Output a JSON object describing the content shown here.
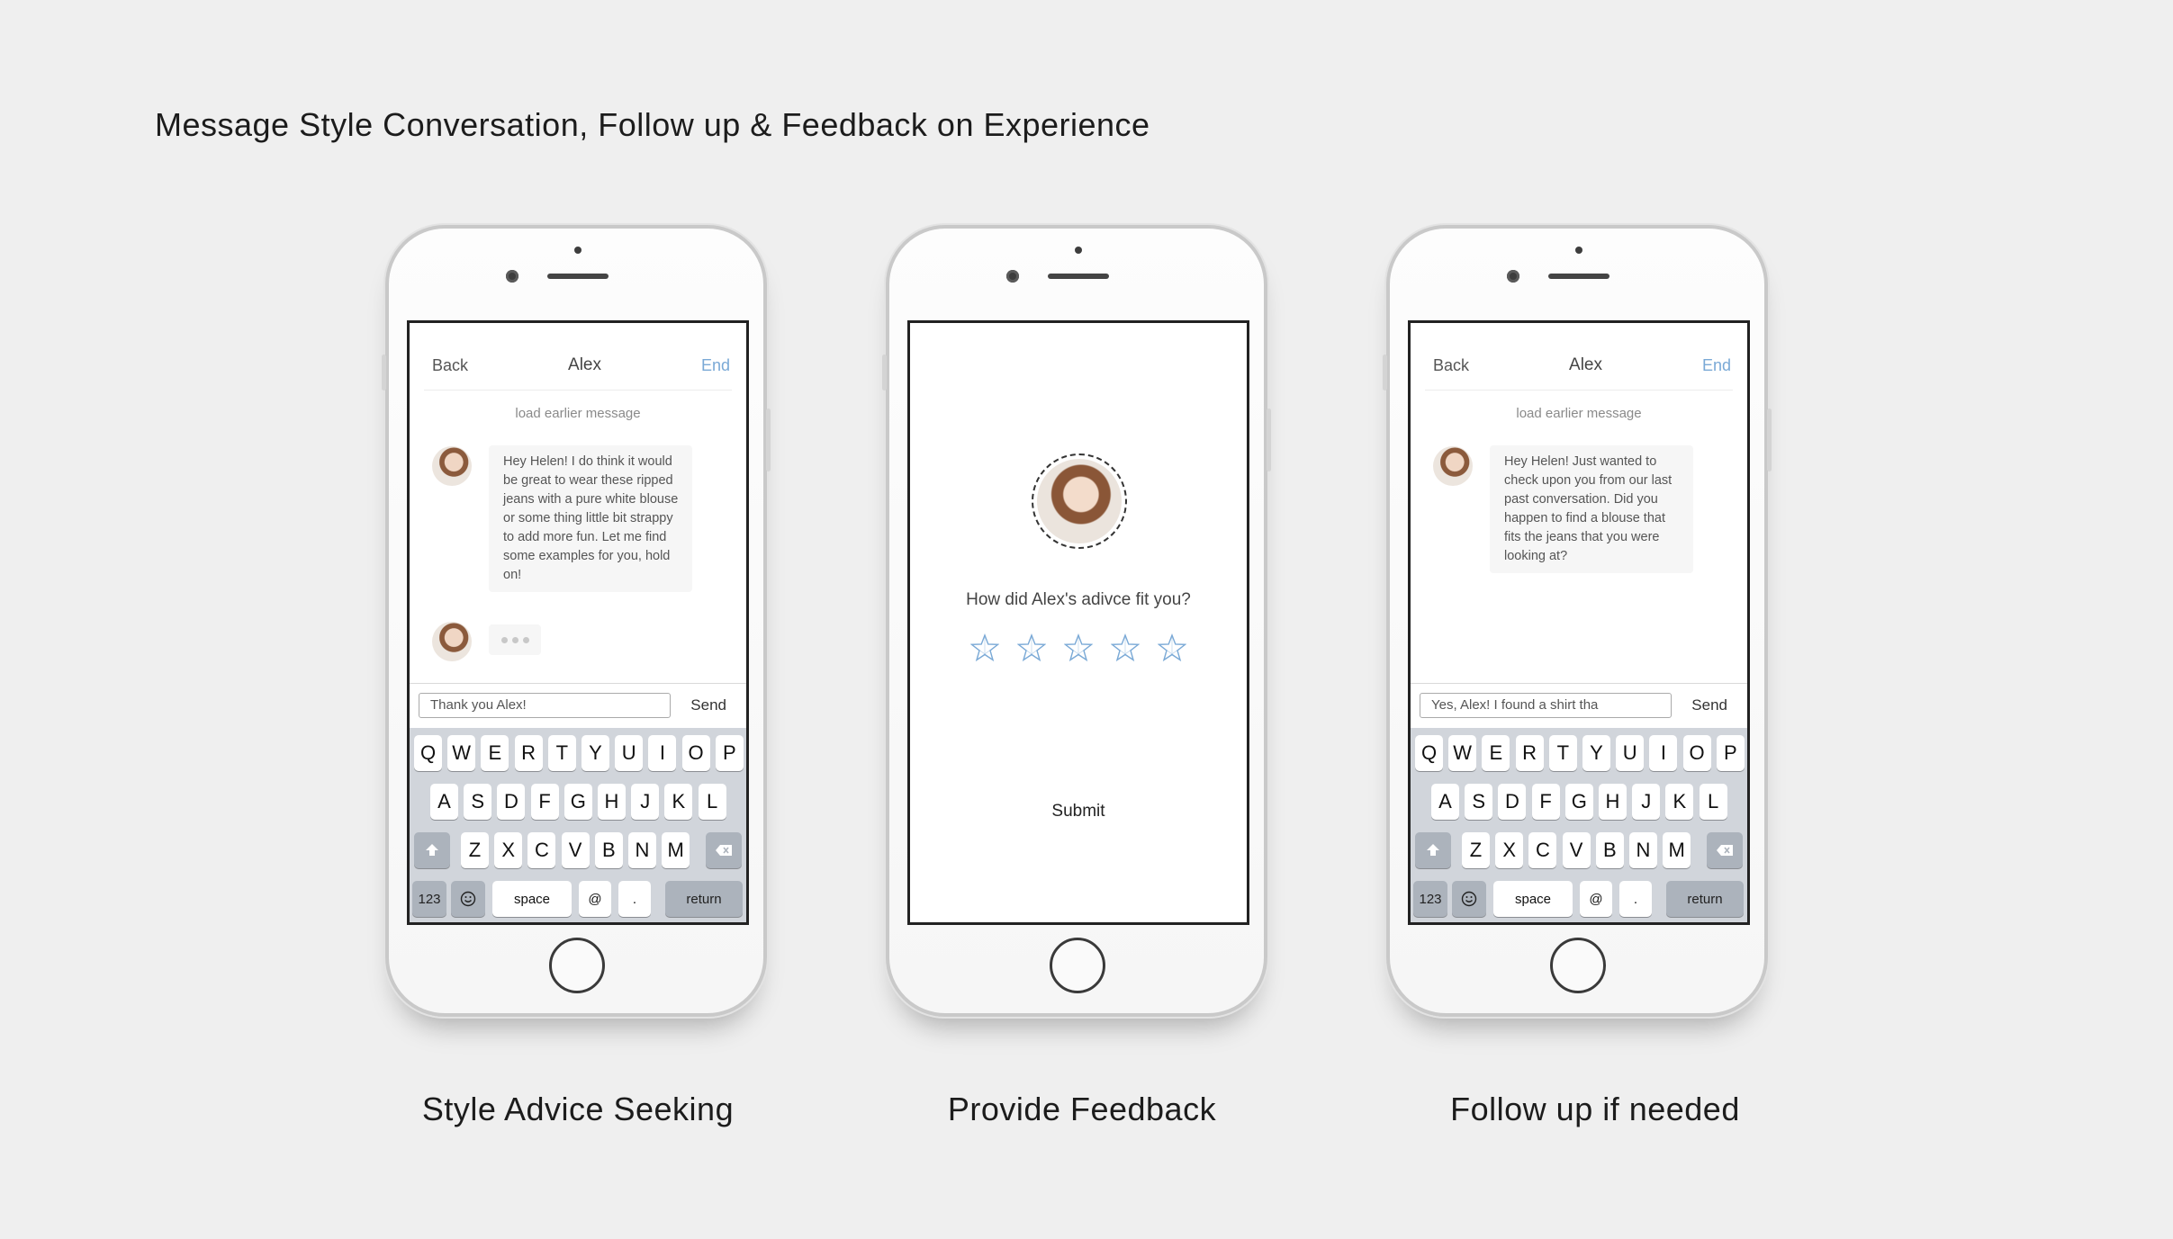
{
  "page_title": "Message Style Conversation, Follow up & Feedback on Experience",
  "captions": [
    "Style Advice Seeking",
    "Provide Feedback",
    "Follow up if needed"
  ],
  "chat1": {
    "back": "Back",
    "title": "Alex",
    "end": "End",
    "load_earlier": "load earlier message",
    "message": "Hey Helen! I do think it would be great to wear these ripped jeans with a pure white blouse or some thing little bit strappy to add more fun. Let me find some examples for you, hold on!",
    "input_value": "Thank you Alex!",
    "send": "Send"
  },
  "feedback": {
    "question": "How did Alex's adivce fit you?",
    "rating_max": 5,
    "rating_value": 0,
    "submit": "Submit"
  },
  "chat2": {
    "back": "Back",
    "title": "Alex",
    "end": "End",
    "load_earlier": "load earlier message",
    "message": "Hey Helen! Just wanted to check upon you from our last past conversation. Did you happen to find a blouse that fits the jeans that you were looking at?",
    "input_value": "Yes, Alex! I found a shirt tha",
    "send": "Send"
  },
  "keyboard": {
    "row1": [
      "Q",
      "W",
      "E",
      "R",
      "T",
      "Y",
      "U",
      "I",
      "O",
      "P"
    ],
    "row2": [
      "A",
      "S",
      "D",
      "F",
      "G",
      "H",
      "J",
      "K",
      "L"
    ],
    "row3": [
      "Z",
      "X",
      "C",
      "V",
      "B",
      "N",
      "M"
    ],
    "numbers": "123",
    "space": "space",
    "at": "@",
    "dot": ".",
    "return": "return"
  },
  "colors": {
    "background": "#efefef",
    "accent_end": "#7aa9d6",
    "star_stroke": "#7aa9d6",
    "keyboard_bg": "#d1d5db"
  }
}
